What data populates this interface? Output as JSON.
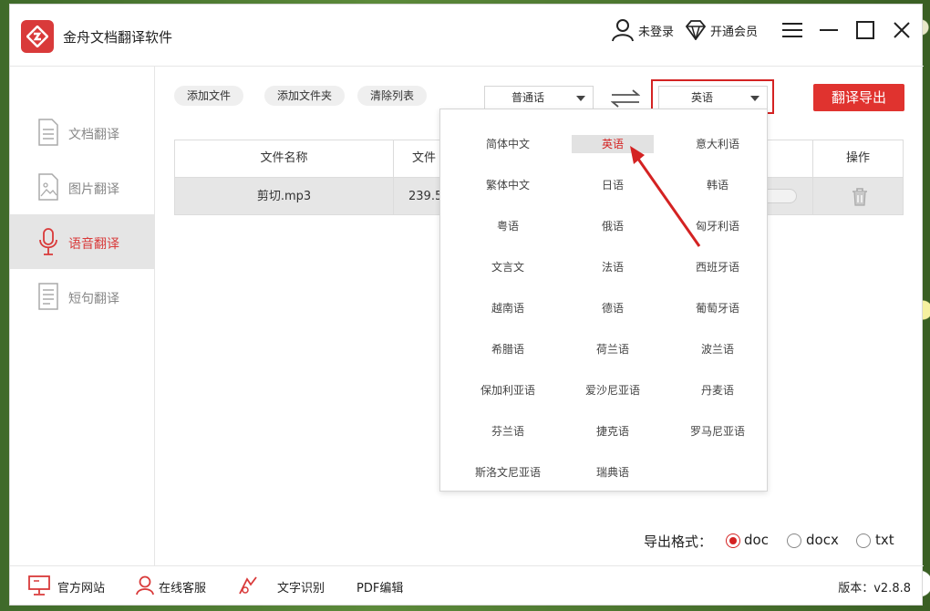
{
  "window": {
    "title": "金舟文档翻译软件"
  },
  "titlebar": {
    "login": "未登录",
    "vip": "开通会员"
  },
  "sidebar": {
    "items": [
      {
        "label": "文档翻译",
        "icon": "document-icon",
        "active": false
      },
      {
        "label": "图片翻译",
        "icon": "image-icon",
        "active": false
      },
      {
        "label": "语音翻译",
        "icon": "microphone-icon",
        "active": true
      },
      {
        "label": "短句翻译",
        "icon": "sentence-icon",
        "active": false
      }
    ]
  },
  "toolbar": {
    "add_file": "添加文件",
    "add_folder": "添加文件夹",
    "clear_list": "清除列表",
    "source_lang": "普通话",
    "target_lang": "英语",
    "export": "翻译导出"
  },
  "table": {
    "headers": {
      "name": "文件名称",
      "size": "文件",
      "action": "操作"
    },
    "rows": [
      {
        "name": "剪切.mp3",
        "size": "239.5"
      }
    ]
  },
  "dropdown": {
    "selected": "英语",
    "options": [
      "简体中文",
      "英语",
      "意大利语",
      "繁体中文",
      "日语",
      "韩语",
      "粤语",
      "俄语",
      "匈牙利语",
      "文言文",
      "法语",
      "西班牙语",
      "越南语",
      "德语",
      "葡萄牙语",
      "希腊语",
      "荷兰语",
      "波兰语",
      "保加利亚语",
      "爱沙尼亚语",
      "丹麦语",
      "芬兰语",
      "捷克语",
      "罗马尼亚语",
      "斯洛文尼亚语",
      "瑞典语"
    ]
  },
  "export_format": {
    "label": "导出格式：",
    "options": [
      "doc",
      "docx",
      "txt"
    ],
    "selected": "doc"
  },
  "footer": {
    "website": "官方网站",
    "service": "在线客服",
    "ocr": "文字识别",
    "pdf": "PDF编辑",
    "version": "版本：v2.8.8"
  },
  "colors": {
    "accent": "#d93a3a",
    "highlight": "#d42222",
    "selected_bg": "#e5e5e5"
  }
}
